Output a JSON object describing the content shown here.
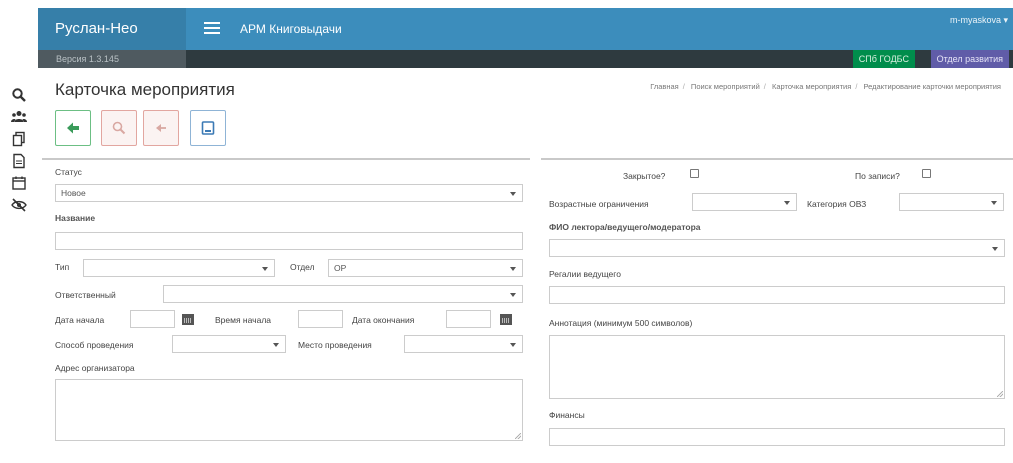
{
  "header": {
    "brand": "Руслан-Нео",
    "app_title": "АРМ Книговыдачи",
    "user": "m-myaskova"
  },
  "version_bar": {
    "version": "Версия 1.3.145",
    "badge_library": "СПб ГОДБС",
    "badge_department": "Отдел развития"
  },
  "sidebar_icons": [
    "search-icon",
    "users-icon",
    "copy-icon",
    "document-icon",
    "calendar-icon",
    "hidden-eye-icon"
  ],
  "page": {
    "title": "Карточка мероприятия",
    "breadcrumb": [
      "Главная",
      "Поиск мероприятий",
      "Карточка мероприятия",
      "Редактирование карточки мероприятия"
    ]
  },
  "toolbar": {
    "buttons": [
      "arrow-left-icon",
      "delete-icon",
      "cancel-icon",
      "save-icon"
    ]
  },
  "colors": {
    "header_blue": "#3c8dbc",
    "brand_blue": "#367fa9",
    "version_bar": "#2e3a3f",
    "badge_green": "#008d4c",
    "badge_purple": "#605ca8"
  },
  "form": {
    "status_label": "Статус",
    "status_value": "Новое",
    "name_label": "Название",
    "name_value": "",
    "type_label": "Тип",
    "type_value": "",
    "department_label": "Отдел",
    "department_value": "ОР",
    "responsible_label": "Ответственный",
    "responsible_value": "",
    "start_date_label": "Дата начала",
    "start_date_value": "",
    "start_time_label": "Время начала",
    "start_time_value": "",
    "end_date_label": "Дата окончания",
    "end_date_value": "",
    "method_label": "Способ проведения",
    "method_value": "",
    "place_label": "Место проведения",
    "place_value": "",
    "organizer_address_label": "Адрес организатора",
    "organizer_address_value": "",
    "closed_label": "Закрытое?",
    "closed_checked": false,
    "by_registration_label": "По записи?",
    "by_registration_checked": false,
    "age_label": "Возрастные ограничения",
    "age_value": "",
    "ovz_label": "Категория ОВЗ",
    "ovz_value": "",
    "lecturer_label": "ФИО лектора/ведущего/модератора",
    "lecturer_value": "",
    "regalia_label": "Регалии ведущего",
    "regalia_value": "",
    "annotation_label": "Аннотация (минимум 500 символов)",
    "annotation_value": "",
    "finance_label": "Финансы",
    "finance_value": ""
  }
}
